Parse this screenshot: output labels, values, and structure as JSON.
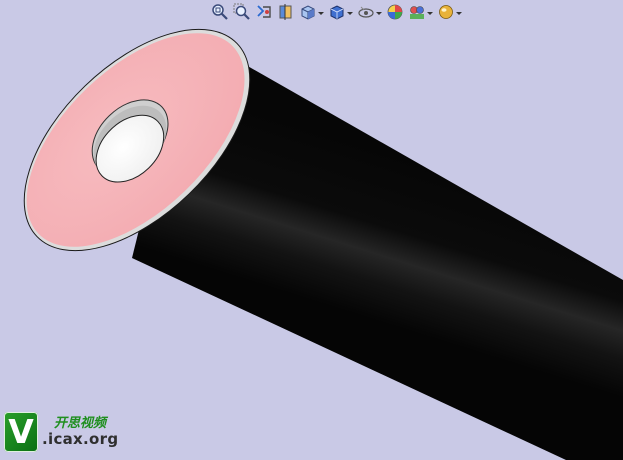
{
  "viewport": {
    "background_color": "#c9c9e6"
  },
  "model": {
    "parts": [
      {
        "name": "outer-jacket",
        "color": "#111111"
      },
      {
        "name": "end-face",
        "color": "#f6b5b8"
      },
      {
        "name": "outer-rim",
        "color": "#ffffff"
      },
      {
        "name": "inner-conductor",
        "color": "#ffffff"
      }
    ]
  },
  "toolbar": {
    "buttons": [
      {
        "icon": "zoom-to-fit-icon",
        "has_dropdown": false
      },
      {
        "icon": "zoom-to-area-icon",
        "has_dropdown": false
      },
      {
        "icon": "previous-view-icon",
        "has_dropdown": false
      },
      {
        "icon": "section-view-icon",
        "has_dropdown": false
      },
      {
        "icon": "view-orientation-icon",
        "has_dropdown": true
      },
      {
        "icon": "display-style-icon",
        "has_dropdown": true
      },
      {
        "icon": "hide-show-items-icon",
        "has_dropdown": true
      },
      {
        "icon": "edit-appearance-icon",
        "has_dropdown": false
      },
      {
        "icon": "apply-scene-icon",
        "has_dropdown": true
      },
      {
        "icon": "view-settings-icon",
        "has_dropdown": true
      }
    ]
  },
  "watermark": {
    "logo_letter": "V",
    "chinese_text": "开思视频",
    "url": ".icax.org",
    "color": "#1f8f1f"
  }
}
